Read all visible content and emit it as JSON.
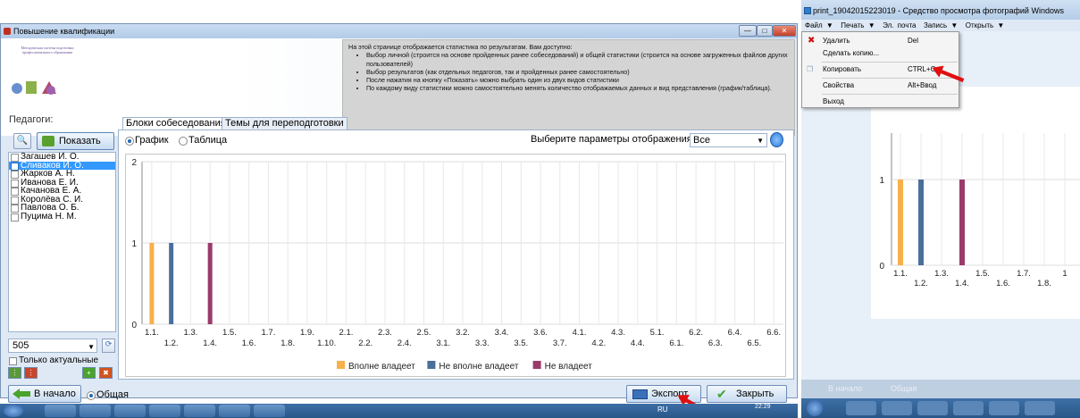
{
  "window": {
    "title": "Повышение квалификации",
    "min": "—",
    "max": "□",
    "close": "✕"
  },
  "logo": {
    "text": "Методическая система подготовки профессионального образования"
  },
  "info": {
    "intro": "На этой странице отображается статистика по результатам. Вам доступно:",
    "items": [
      "Выбор личной (строится на основе пройденных ранее собеседований) и общей статистики (строится на основе загруженных файлов других пользователей)",
      "Выбор результатов (как отдельных педагогов, так и пройденных ранее самостоятельно)",
      "После нажатия на кнопку «Показать» можно выбрать один из двух видов статистики",
      "По каждому виду статистики можно самостоятельно менять количество отображаемых данных и вид представления (график/таблица)."
    ]
  },
  "left": {
    "teachers_label": "Педагоги:",
    "show_button": "Показать",
    "teachers": [
      {
        "name": "Загашев И. О.",
        "checked": false
      },
      {
        "name": "Сливаков И. О.",
        "checked": true
      },
      {
        "name": "Жарков А. Н.",
        "checked": false
      },
      {
        "name": "Иванова Е. И.",
        "checked": false
      },
      {
        "name": "Качанова Е. А.",
        "checked": false
      },
      {
        "name": "Королёва С. И.",
        "checked": false
      },
      {
        "name": "Павлова О. Б.",
        "checked": false
      },
      {
        "name": "Пуцима Н. М.",
        "checked": false
      }
    ],
    "group_value": "505",
    "only_actual": "Только актуальные"
  },
  "tabs": [
    "Блоки собеседования",
    "Темы для переподготовки"
  ],
  "view": {
    "graph": "График",
    "table": "Таблица",
    "params_label": "Выберите параметры отображения :",
    "params_value": "Все"
  },
  "chart_data": {
    "type": "bar",
    "categories": [
      "1.1.",
      "1.2.",
      "1.3.",
      "1.4.",
      "1.5.",
      "1.6.",
      "1.7.",
      "1.8.",
      "1.9.",
      "1.10.",
      "2.1.",
      "2.2.",
      "2.3.",
      "2.4.",
      "2.5.",
      "3.1.",
      "3.2.",
      "3.3.",
      "3.4.",
      "3.5.",
      "3.6.",
      "3.7.",
      "4.1.",
      "4.2.",
      "4.3.",
      "4.4.",
      "5.1.",
      "6.1.",
      "6.2.",
      "6.3.",
      "6.4.",
      "6.5.",
      "6.6."
    ],
    "series": [
      {
        "name": "Вполне владеет",
        "color": "#f7b04a",
        "values": [
          1,
          0,
          0,
          0,
          0,
          0,
          0,
          0,
          0,
          0,
          0,
          0,
          0,
          0,
          0,
          0,
          0,
          0,
          0,
          0,
          0,
          0,
          0,
          0,
          0,
          0,
          0,
          0,
          0,
          0,
          0,
          0,
          0
        ]
      },
      {
        "name": "Не вполне владеет",
        "color": "#4a6f9c",
        "values": [
          0,
          1,
          0,
          0,
          0,
          0,
          0,
          0,
          0,
          0,
          0,
          0,
          0,
          0,
          0,
          0,
          0,
          0,
          0,
          0,
          0,
          0,
          0,
          0,
          0,
          0,
          0,
          0,
          0,
          0,
          0,
          0,
          0
        ]
      },
      {
        "name": "Не владеет",
        "color": "#9b3a6a",
        "values": [
          0,
          0,
          0,
          1,
          0,
          0,
          0,
          0,
          0,
          0,
          0,
          0,
          0,
          0,
          0,
          0,
          0,
          0,
          0,
          0,
          0,
          0,
          0,
          0,
          0,
          0,
          0,
          0,
          0,
          0,
          0,
          0,
          0
        ]
      }
    ],
    "yticks": [
      "0",
      "1",
      "2"
    ],
    "ylim": [
      0,
      2
    ],
    "grid": true,
    "legend": "bottom"
  },
  "bottom": {
    "home": "В начало",
    "common": "Общая",
    "export": "Экспорт",
    "close": "Закрыть"
  },
  "taskbar": {
    "lang": "RU",
    "time": "22:29"
  },
  "viewer": {
    "title": "print_19042015223019 - Средство просмотра фотографий Windows",
    "menu": [
      "Файл ▼",
      "Печать ▼",
      "Эл. почта",
      "Запись ▼",
      "Открыть ▼"
    ],
    "context": [
      {
        "label": "Удалить",
        "key": "Del"
      },
      {
        "label": "Сделать копию...",
        "key": ""
      },
      {
        "label": "Копировать",
        "key": "CTRL+C"
      },
      {
        "label": "Свойства",
        "key": "Alt+Ввод"
      },
      {
        "label": "Выход",
        "key": ""
      }
    ],
    "chart_ticks": [
      "1.1.",
      "1.2.",
      "1.3.",
      "1.4.",
      "1.5.",
      "1.6.",
      "1.7.",
      "1.8.",
      "1"
    ],
    "yticks": [
      "0",
      "1"
    ],
    "bottom_home": "В начало",
    "bottom_common": "Общая"
  }
}
